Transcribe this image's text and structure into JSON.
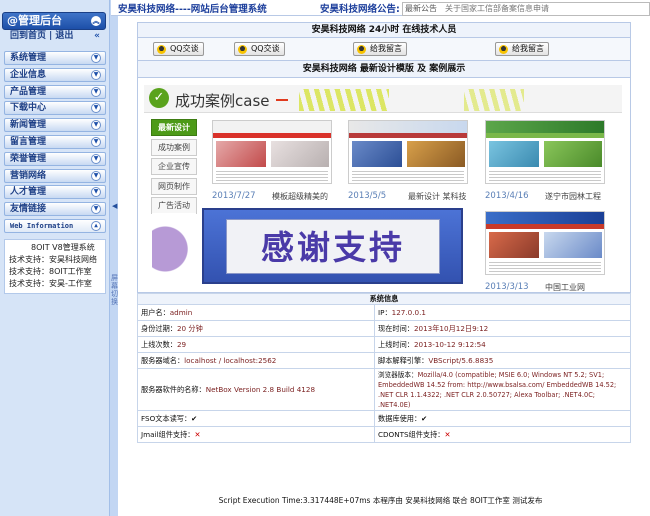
{
  "sidebar": {
    "header_title": "@管理后台",
    "header_collapse_icon": "double-chevron-up-icon",
    "links": [
      "回到首页",
      "退出"
    ],
    "link_separator": "|",
    "links_icon": "double-chevron-left-icon",
    "menu": [
      {
        "label": "系统管理"
      },
      {
        "label": "企业信息"
      },
      {
        "label": "产品管理"
      },
      {
        "label": "下载中心"
      },
      {
        "label": "新闻管理"
      },
      {
        "label": "留言管理"
      },
      {
        "label": "荣誉管理"
      },
      {
        "label": "营销网络"
      },
      {
        "label": "人才管理"
      },
      {
        "label": "友情链接"
      },
      {
        "label": "Web Information"
      }
    ],
    "info": {
      "title": "8OIT V8管理系统",
      "lines": [
        "技术支持：安昊科技网络",
        "技术支持：8OIT工作室",
        "技术支持：安昊-工作室"
      ]
    },
    "splitter_text": "屏幕切换"
  },
  "topbar": {
    "site_title": "安昊科技网络----网站后台管理系统",
    "notice_label": "安昊科技网络公告:",
    "notice_text": "最新公告",
    "notice_scroll": "关于国家工信部备案信息申请"
  },
  "main": {
    "support_title": "安昊科技网络 24小时 在线技术人员",
    "buttons": [
      "QQ交谈",
      "QQ交谈",
      "给我留言",
      "给我留言"
    ],
    "button_icon": "qq-penguin-icon",
    "template_title": "安昊科技网络 最新设计模版 及 案例展示",
    "banner_heading": "成功案例case",
    "categories": [
      {
        "label": "最新设计",
        "active": true
      },
      {
        "label": "成功案例",
        "active": false
      },
      {
        "label": "企业宣传",
        "active": false
      },
      {
        "label": "网页制作",
        "active": false
      },
      {
        "label": "广告活动",
        "active": false
      }
    ],
    "cases": [
      {
        "date": "2013/7/27",
        "caption": "模板超级精美的"
      },
      {
        "date": "2013/5/5",
        "caption": "最新设计 某科技"
      },
      {
        "date": "2013/4/16",
        "caption": "遂宁市园林工程"
      },
      {
        "date": "2013/3/13",
        "caption": "中国工业网"
      }
    ],
    "overlay_text": "感谢支持"
  },
  "sysinfo": {
    "title": "系统信息",
    "rows": [
      [
        {
          "k": "用户名：",
          "v": "admin"
        },
        {
          "k": "IP：",
          "v": "127.0.0.1"
        }
      ],
      [
        {
          "k": "身份过期：",
          "v": "20 分钟"
        },
        {
          "k": "现在时间：",
          "v": "2013年10月12日9:12"
        }
      ],
      [
        {
          "k": "上线次数：",
          "v": "29"
        },
        {
          "k": "上线时间：",
          "v": "2013-10-12 9:12:54"
        }
      ],
      [
        {
          "k": "服务器域名：",
          "v": "localhost / localhost:2562"
        },
        {
          "k": "脚本解释引擎：",
          "v": "VBScript/5.6.8835"
        }
      ],
      [
        {
          "k": "服务器软件的名称：",
          "v": "NetBox Version 2.8 Build 4128"
        },
        {
          "k": "浏览器版本：",
          "v": "Mozilla/4.0 (compatible; MSIE 6.0; Windows NT 5.2; SV1; EmbeddedWB 14.52 from: http://www.bsalsa.com/ EmbeddedWB 14.52; .NET CLR 1.1.4322; .NET CLR 2.0.50727; Alexa Toolbar; .NET4.0C; .NET4.0E)"
        }
      ],
      [
        {
          "k": "FSO文本读写：",
          "v": "✔"
        },
        {
          "k": "数据库使用：",
          "v": "✔"
        }
      ],
      [
        {
          "k": "Jmail组件支持：",
          "v": "✕"
        },
        {
          "k": "CDONTS组件支持：",
          "v": "✕"
        }
      ]
    ]
  },
  "footer": "Script Execution Time:3.317448E+07ms 本程序由 安昊科技网络 联合 8OIT工作室 测试发布",
  "colors": {
    "accent": "#1d4fa8",
    "active_category": "#4d9a18",
    "overlay": "#3f62c6"
  }
}
